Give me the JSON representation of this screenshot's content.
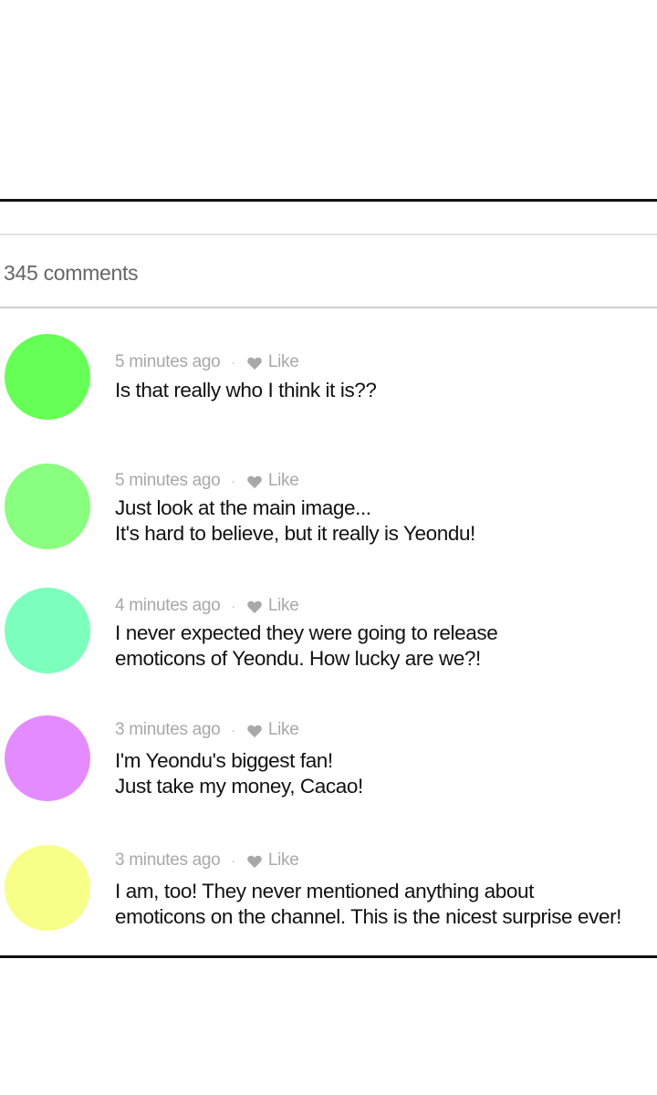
{
  "header": {
    "comment_count": "345 comments"
  },
  "colors": {
    "avatar_1": "#66ff55",
    "avatar_2": "#88ff7e",
    "avatar_3": "#7cffbd",
    "avatar_4": "#e48cff",
    "avatar_5": "#f8ff88",
    "meta_text": "#a8a8a8",
    "comment_text": "#111111"
  },
  "comments": [
    {
      "time": "5 minutes ago",
      "separator": "·",
      "like_label": "Like",
      "like_icon": "heart-icon",
      "lines": [
        "Is that really who I think it is??"
      ]
    },
    {
      "time": "5 minutes ago",
      "separator": "·",
      "like_label": "Like",
      "like_icon": "heart-icon",
      "lines": [
        "Just look at the main image...",
        "It's hard to believe, but it really is Yeondu!"
      ]
    },
    {
      "time": "4 minutes ago",
      "separator": "·",
      "like_label": "Like",
      "like_icon": "heart-icon",
      "lines": [
        "I never expected they were going to release",
        "emoticons of Yeondu. How lucky are we?!"
      ]
    },
    {
      "time": "3 minutes ago",
      "separator": "·",
      "like_label": "Like",
      "like_icon": "heart-icon",
      "lines": [
        "I'm Yeondu's biggest fan!",
        "Just take my money, Cacao!"
      ]
    },
    {
      "time": "3 minutes ago",
      "separator": "·",
      "like_label": "Like",
      "like_icon": "heart-icon",
      "lines": [
        "I am, too! They never mentioned anything about",
        "emoticons on the channel. This is the nicest surprise ever!"
      ]
    }
  ]
}
